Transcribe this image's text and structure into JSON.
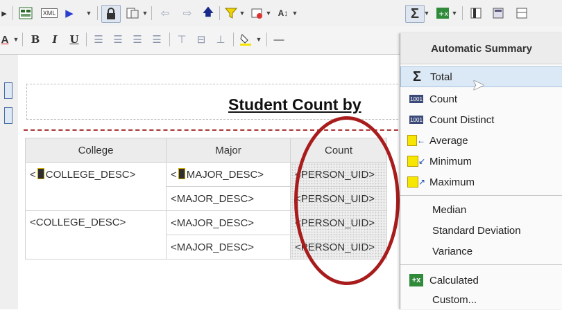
{
  "toolbar1": {
    "xml_label": "XML"
  },
  "toolbar2": {
    "bold": "B",
    "italic": "I",
    "underline": "U"
  },
  "report": {
    "title": "Student Count by",
    "columns": [
      "College",
      "Major",
      "Count"
    ],
    "rows": [
      {
        "college": "<COLLEGE_DESC>",
        "major": "<MAJOR_DESC>",
        "count": "<PERSON_UID>"
      },
      {
        "college": "",
        "major": "<MAJOR_DESC>",
        "count": "<PERSON_UID>"
      },
      {
        "college": "<COLLEGE_DESC>",
        "major": "<MAJOR_DESC>",
        "count": "<PERSON_UID>"
      },
      {
        "college": "",
        "major": "<MAJOR_DESC>",
        "count": "<PERSON_UID>"
      }
    ]
  },
  "menu": {
    "header": "Automatic Summary",
    "items": {
      "total": "Total",
      "count": "Count",
      "count_distinct": "Count Distinct",
      "average": "Average",
      "minimum": "Minimum",
      "maximum": "Maximum",
      "median": "Median",
      "std_dev": "Standard Deviation",
      "variance": "Variance",
      "calculated": "Calculated",
      "custom": "Custom..."
    },
    "count_badge": "1001"
  },
  "colors": {
    "highlight_oval": "#a81c1c",
    "menu_hover": "#dbe8f6",
    "table_header": "#ececec"
  }
}
